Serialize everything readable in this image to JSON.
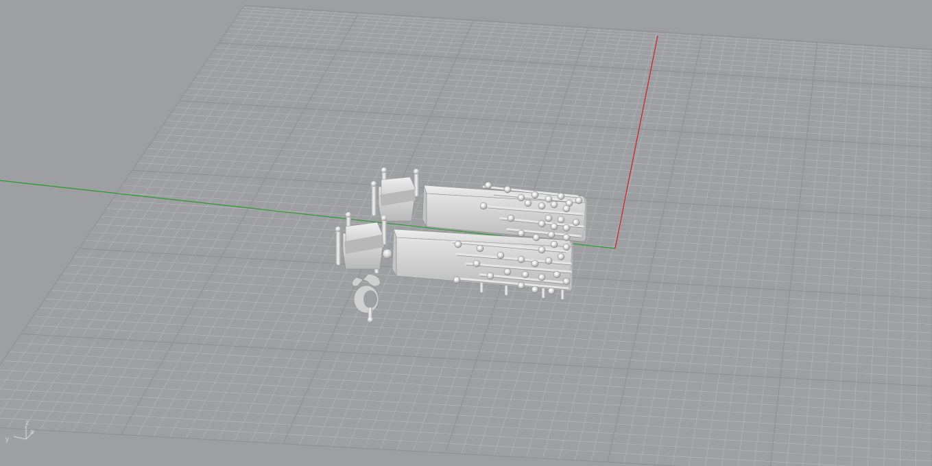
{
  "viewport": {
    "kind": "perspective",
    "background_color": "#9d9fa2",
    "grid_minor_color": "#b4b6b9",
    "grid_major_color": "#8d8f92",
    "x_axis_color": "#c8201e",
    "y_axis_color": "#2a9a2a",
    "model_color": "#d6d6d6"
  },
  "gizmo": {
    "z_label": "z",
    "x_label": "x",
    "y_label": "y"
  }
}
